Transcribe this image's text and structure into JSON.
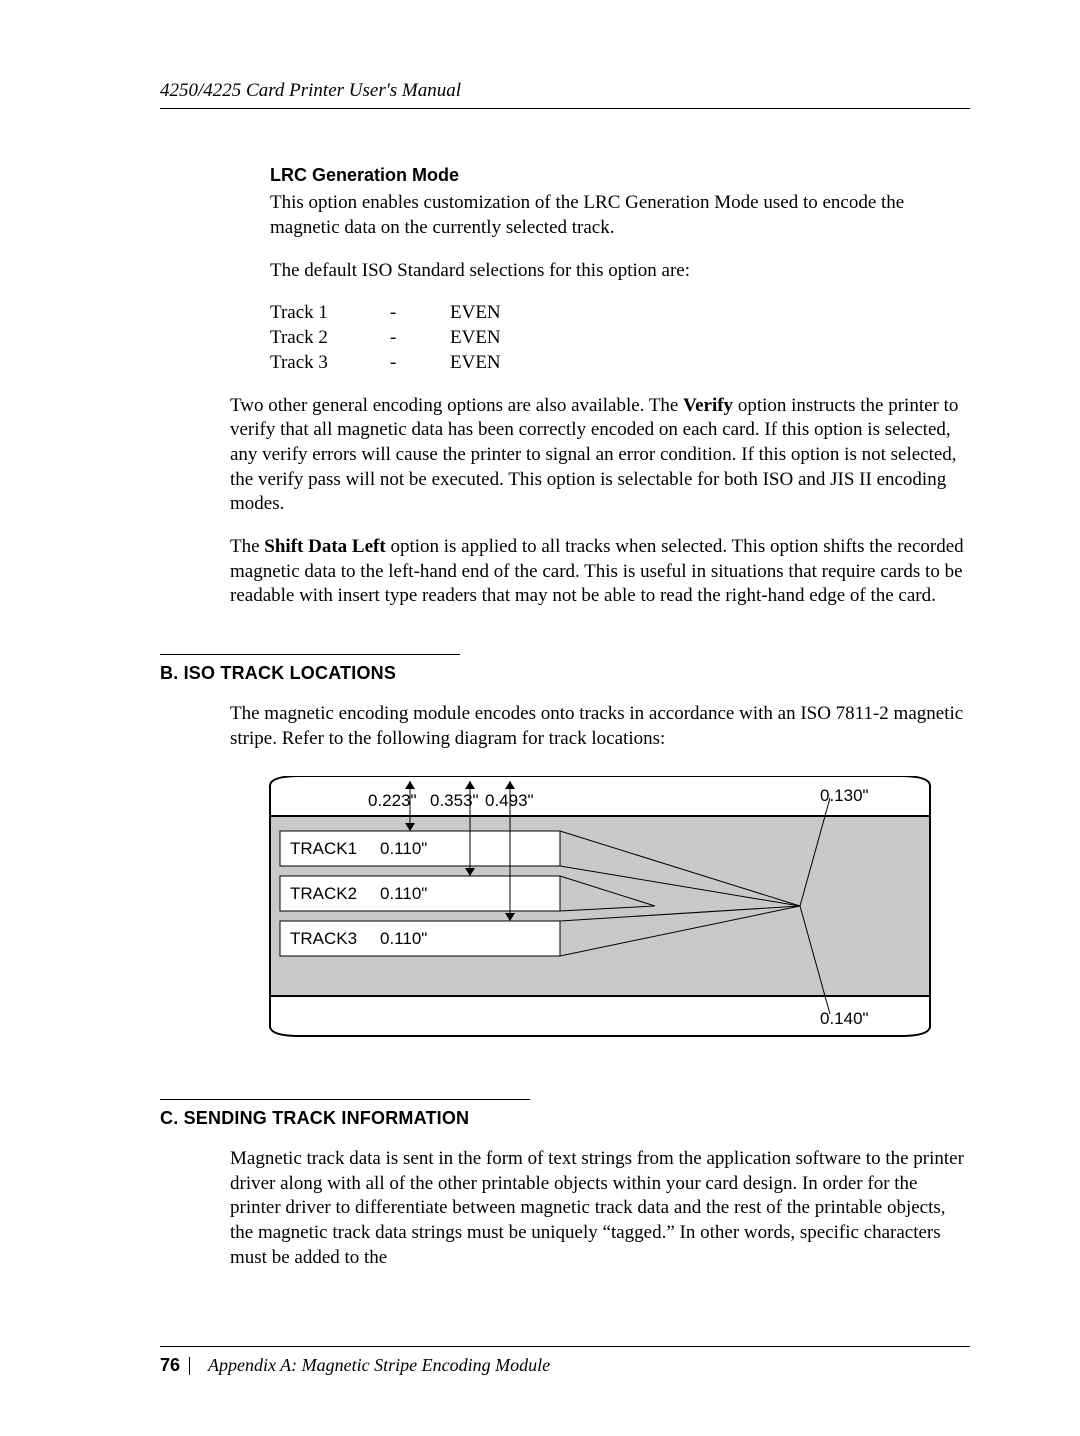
{
  "header": {
    "running_title": "4250/4225 Card Printer User's Manual"
  },
  "lrc": {
    "heading": "LRC Generation Mode",
    "para1": "This option enables customization of the LRC Generation Mode used to encode the magnetic data on the currently selected track.",
    "para2": "The default ISO Standard selections for this option are:",
    "table": [
      {
        "track": "Track 1",
        "dash": "-",
        "value": "EVEN"
      },
      {
        "track": "Track 2",
        "dash": "-",
        "value": "EVEN"
      },
      {
        "track": "Track 3",
        "dash": "-",
        "value": "EVEN"
      }
    ]
  },
  "general": {
    "para1_a": "Two other general encoding options are also available. The ",
    "verify_label": "Verify",
    "para1_b": " option instructs the printer to verify that all magnetic data has been correctly encoded on each card. If this option is selected, any verify errors will cause the printer to signal an error condition. If this option is not selected, the verify pass will not be executed. This option is selectable for both ISO and JIS II encoding modes.",
    "para2_a": "The ",
    "shift_label": "Shift Data Left",
    "para2_b": " option is applied to all tracks when selected. This option shifts the recorded magnetic data to the left-hand end of the card. This is useful in situations that require cards to be readable with insert type readers that may not be able to read the right-hand edge of the card."
  },
  "section_b": {
    "heading": "B. ISO TRACK LOCATIONS",
    "para": "The magnetic encoding module encodes onto tracks in accordance with an ISO 7811-2 magnetic stripe. Refer to the following diagram for track locations:"
  },
  "diagram": {
    "tracks": [
      {
        "name": "TRACK1",
        "width": "0.110\""
      },
      {
        "name": "TRACK2",
        "width": "0.110\""
      },
      {
        "name": "TRACK3",
        "width": "0.110\""
      }
    ],
    "offsets": {
      "a": "0.223\"",
      "b": "0.353\"",
      "c": "0.493\""
    },
    "edge_top": "0.130\"",
    "edge_bottom": "0.140\""
  },
  "section_c": {
    "heading": "C. SENDING TRACK INFORMATION",
    "para": "Magnetic track data is sent in the form of text strings from the application software to the printer driver along with all of the other printable objects within your card design. In order for the printer driver to differentiate between magnetic track data and the rest of the printable objects, the magnetic track data strings must be uniquely “tagged.” In other words, specific characters must be added to the"
  },
  "footer": {
    "page": "76",
    "text": "Appendix A:  Magnetic Stripe Encoding Module"
  }
}
